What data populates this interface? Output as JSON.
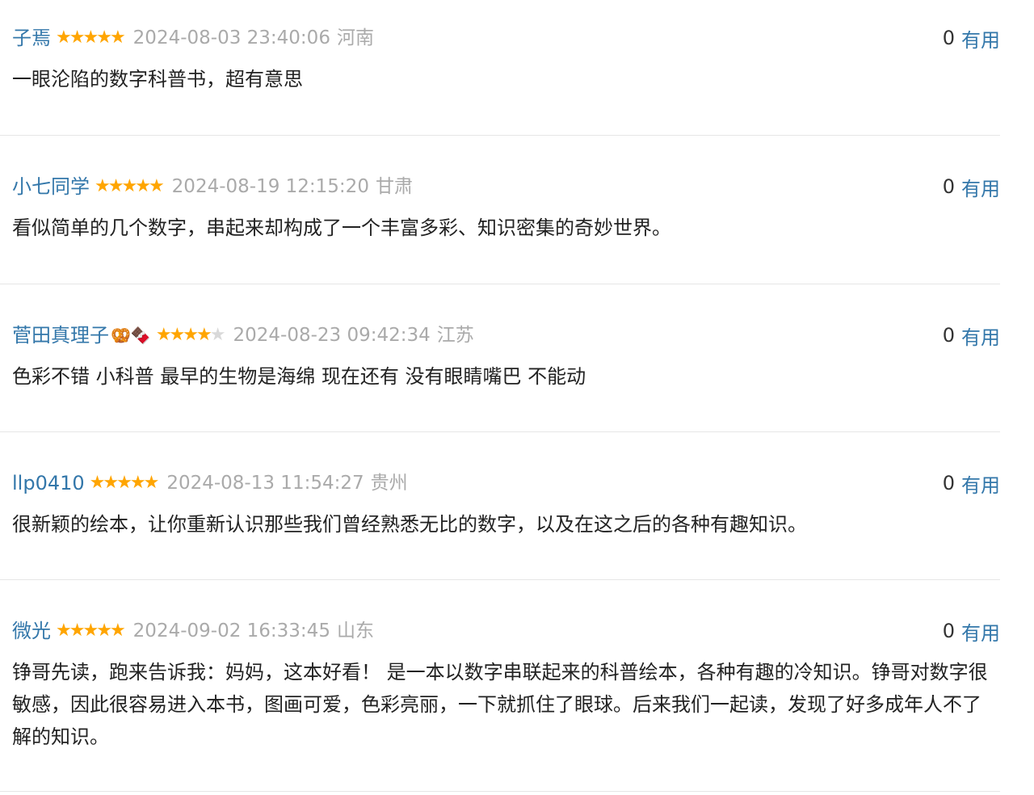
{
  "comments": [
    {
      "username": "子焉",
      "badge": "",
      "rating": 5,
      "time": "2024-08-03 23:40:06",
      "location": "河南",
      "useful_count": "0",
      "useful_label": "有用",
      "text": "一眼沦陷的数字科普书，超有意思"
    },
    {
      "username": "小七同学",
      "badge": "",
      "rating": 5,
      "time": "2024-08-19 12:15:20",
      "location": "甘肃",
      "useful_count": "0",
      "useful_label": "有用",
      "text": "看似简单的几个数字，串起来却构成了一个丰富多彩、知识密集的奇妙世界。"
    },
    {
      "username": "菅田真理子",
      "badge": "🥨🍫",
      "rating": 4,
      "time": "2024-08-23 09:42:34",
      "location": "江苏",
      "useful_count": "0",
      "useful_label": "有用",
      "text": "色彩不错 小科普 最早的生物是海绵 现在还有 没有眼睛嘴巴 不能动"
    },
    {
      "username": "llp0410",
      "badge": "",
      "rating": 5,
      "time": "2024-08-13 11:54:27",
      "location": "贵州",
      "useful_count": "0",
      "useful_label": "有用",
      "text": "很新颖的绘本，让你重新认识那些我们曾经熟悉无比的数字，以及在这之后的各种有趣知识。"
    },
    {
      "username": "微光",
      "badge": "",
      "rating": 5,
      "time": "2024-09-02 16:33:45",
      "location": "山东",
      "useful_count": "0",
      "useful_label": "有用",
      "text": "铮哥先读，跑来告诉我：妈妈，这本好看！ 是一本以数字串联起来的科普绘本，各种有趣的冷知识。铮哥对数字很敏感，因此很容易进入本书，图画可爱，色彩亮丽，一下就抓住了眼球。后来我们一起读，发现了好多成年人不了解的知识。"
    }
  ],
  "colors": {
    "link": "#3377aa",
    "star_on": "#ffa500",
    "star_off": "#d9d9d9",
    "meta": "#aaaaaa",
    "text": "#222222",
    "divider": "#e6e6e6"
  }
}
